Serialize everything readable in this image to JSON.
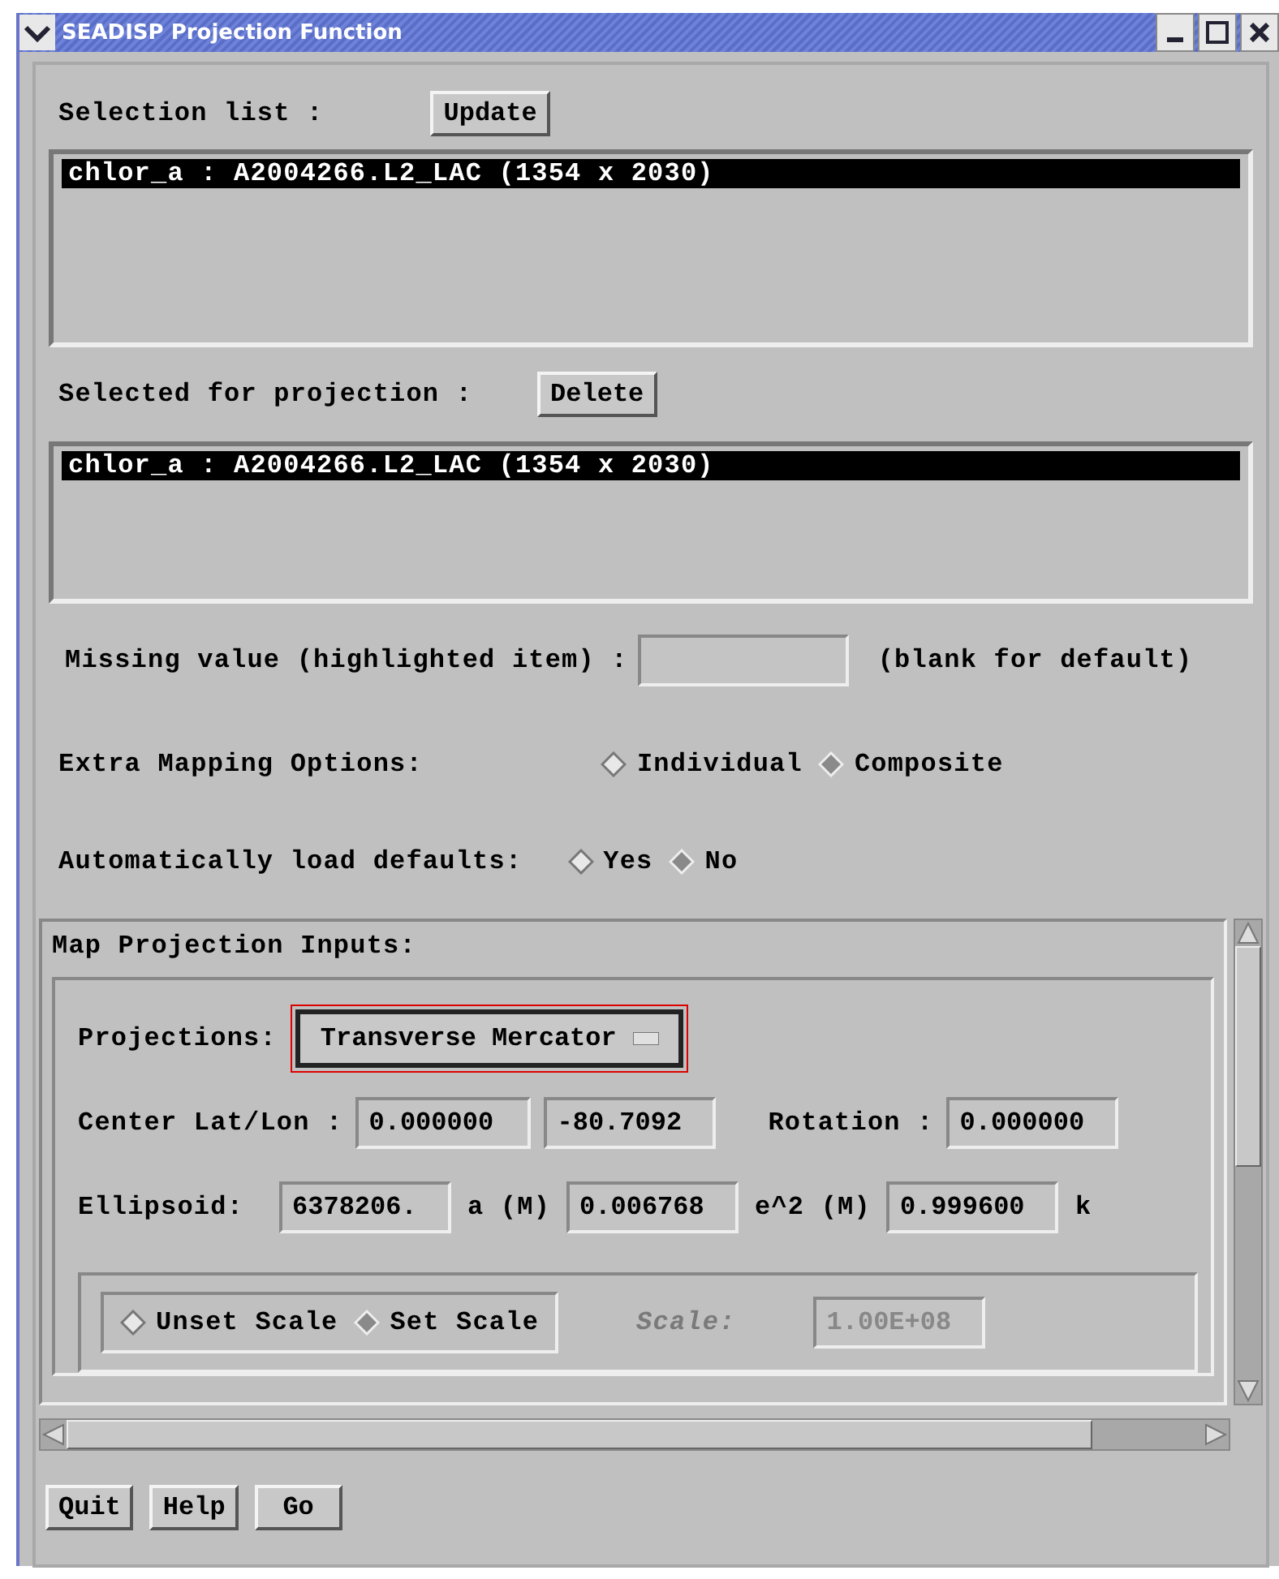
{
  "window": {
    "title": "SEADISP Projection Function"
  },
  "selection_list": {
    "label": "Selection list :",
    "button": "Update",
    "items": [
      {
        "text": "chlor_a : A2004266.L2_LAC (1354 x 2030)",
        "selected": true
      }
    ]
  },
  "selected_for_projection": {
    "label": "Selected for projection :",
    "button": "Delete",
    "items": [
      {
        "text": "chlor_a : A2004266.L2_LAC (1354 x 2030)",
        "selected": true
      }
    ]
  },
  "missing_value": {
    "label": "Missing value (highlighted item) :",
    "hint": "(blank for default)"
  },
  "extra_mapping_options": {
    "label": "Extra Mapping Options:",
    "options": [
      {
        "label": "Individual",
        "selected": true
      },
      {
        "label": "Composite",
        "selected": false
      }
    ]
  },
  "auto_load_defaults": {
    "label": "Automatically load defaults:",
    "options": [
      {
        "label": "Yes",
        "selected": true
      },
      {
        "label": "No",
        "selected": false
      }
    ]
  },
  "map_projection_inputs": {
    "title": "Map Projection Inputs:",
    "projections": {
      "label": "Projections:",
      "value": "Transverse Mercator"
    },
    "center": {
      "label": "Center Lat/Lon :",
      "lat": "0.000000",
      "lon": "-80.7092",
      "rotation_label": "Rotation :",
      "rotation": "0.000000"
    },
    "ellipsoid": {
      "label": "Ellipsoid:",
      "fields": [
        {
          "value": "6378206.",
          "unit": "a (M)"
        },
        {
          "value": "0.006768",
          "unit": "e^2 (M)"
        },
        {
          "value": "0.999600",
          "unit": "k"
        }
      ]
    },
    "scale_options": [
      {
        "label": "Unset Scale",
        "selected": true
      },
      {
        "label": "Set Scale",
        "selected": false
      }
    ],
    "scale": {
      "label": "Scale:",
      "value": "1.00E+08",
      "disabled": true
    }
  },
  "buttons": [
    "Quit",
    "Help",
    "Go"
  ]
}
